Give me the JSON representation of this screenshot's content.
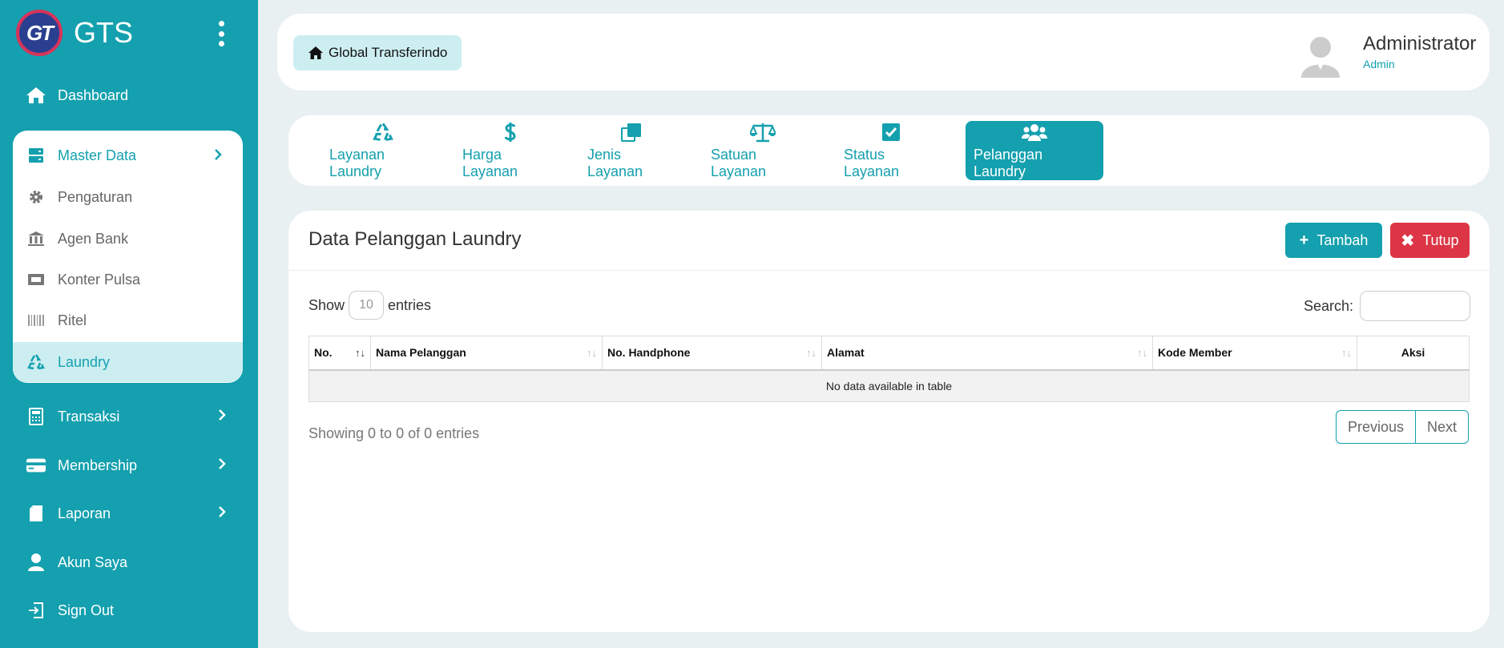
{
  "brand": {
    "name": "GTS",
    "logo_text": "GT"
  },
  "sidebar": {
    "dashboard": "Dashboard",
    "master_data": "Master Data",
    "sub_items": [
      "Pengaturan",
      "Agen Bank",
      "Konter Pulsa",
      "Ritel",
      "Laundry"
    ],
    "transaksi": "Transaksi",
    "membership": "Membership",
    "laporan": "Laporan",
    "akun_saya": "Akun Saya",
    "sign_out": "Sign Out"
  },
  "header": {
    "home_label": "Global Transferindo",
    "user_name": "Administrator",
    "user_role": "Admin"
  },
  "tabs": [
    {
      "label": "Layanan Laundry",
      "icon": "recycle-icon"
    },
    {
      "label": "Harga Layanan",
      "icon": "dollar-icon"
    },
    {
      "label": "Jenis Layanan",
      "icon": "clone-icon"
    },
    {
      "label": "Satuan Layanan",
      "icon": "balance-scale-icon"
    },
    {
      "label": "Status Layanan",
      "icon": "check-square-icon"
    },
    {
      "label": "Pelanggan Laundry",
      "icon": "users-icon",
      "active": true
    }
  ],
  "card": {
    "title": "Data Pelanggan Laundry",
    "add_label": "Tambah",
    "close_label": "Tutup",
    "show_label": "Show",
    "entries_value": "10",
    "entries_label": "entries",
    "search_label": "Search:",
    "columns": [
      "No.",
      "Nama Pelanggan",
      "No. Handphone",
      "Alamat",
      "Kode Member",
      "Aksi"
    ],
    "empty_message": "No data available in table",
    "info": "Showing 0 to 0 of 0 entries",
    "previous": "Previous",
    "next": "Next"
  },
  "colors": {
    "primary": "#14a0ae",
    "danger": "#dc3545",
    "light": "#cdeef1"
  }
}
